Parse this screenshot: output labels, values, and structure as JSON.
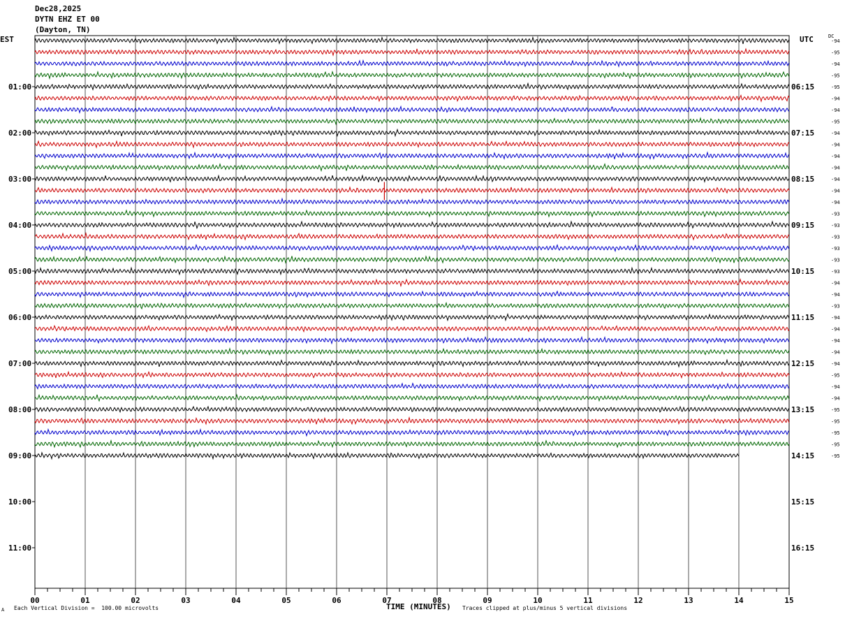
{
  "header": {
    "date": "Dec28,2025",
    "station": "DYTN EHZ ET 00",
    "location": "(Dayton, TN)"
  },
  "left_axis_label": "EST",
  "right_axis_label": "UTC",
  "dc_label": "DC",
  "footer": {
    "left_mark": "A",
    "scale_note": "Each Vertical Division =  100.00 microvolts",
    "clip_note": "Traces clipped at plus/minus 5 vertical divisions"
  },
  "chart_data": {
    "type": "line",
    "title": "DYTN EHZ ET 00 (Dayton, TN)",
    "xlabel": "TIME (MINUTES)",
    "xlim": [
      0,
      15
    ],
    "x_ticks": [
      "00",
      "01",
      "02",
      "03",
      "04",
      "05",
      "06",
      "07",
      "08",
      "09",
      "10",
      "11",
      "12",
      "13",
      "14",
      "15"
    ],
    "rows_per_hour": 4,
    "minutes_per_row": 15,
    "trace_colors": [
      "#000000",
      "#cc0000",
      "#0000cc",
      "#006600"
    ],
    "est_hour_labels": [
      "01:00",
      "02:00",
      "03:00",
      "04:00",
      "05:00",
      "06:00",
      "07:00",
      "08:00",
      "09:00",
      "10:00",
      "11:00"
    ],
    "utc_hour_labels": [
      "06:15",
      "07:15",
      "08:15",
      "09:15",
      "10:15",
      "11:15",
      "12:15",
      "13:15",
      "14:15",
      "15:15",
      "16:15"
    ],
    "dc_offsets": [
      "94",
      "95",
      "94",
      "95",
      "95",
      "94",
      "94",
      "95",
      "94",
      "94",
      "94",
      "94",
      "94",
      "94",
      "94",
      "93",
      "93",
      "93",
      "93",
      "93",
      "93",
      "94",
      "94",
      "93",
      "94",
      "94",
      "94",
      "94",
      "94",
      "95",
      "94",
      "94",
      "95",
      "95",
      "95",
      "95",
      "95"
    ],
    "last_row_end_minute": 14.0,
    "notable_events": [
      {
        "row": 13,
        "minute": 6.95,
        "description": "spike"
      }
    ]
  }
}
